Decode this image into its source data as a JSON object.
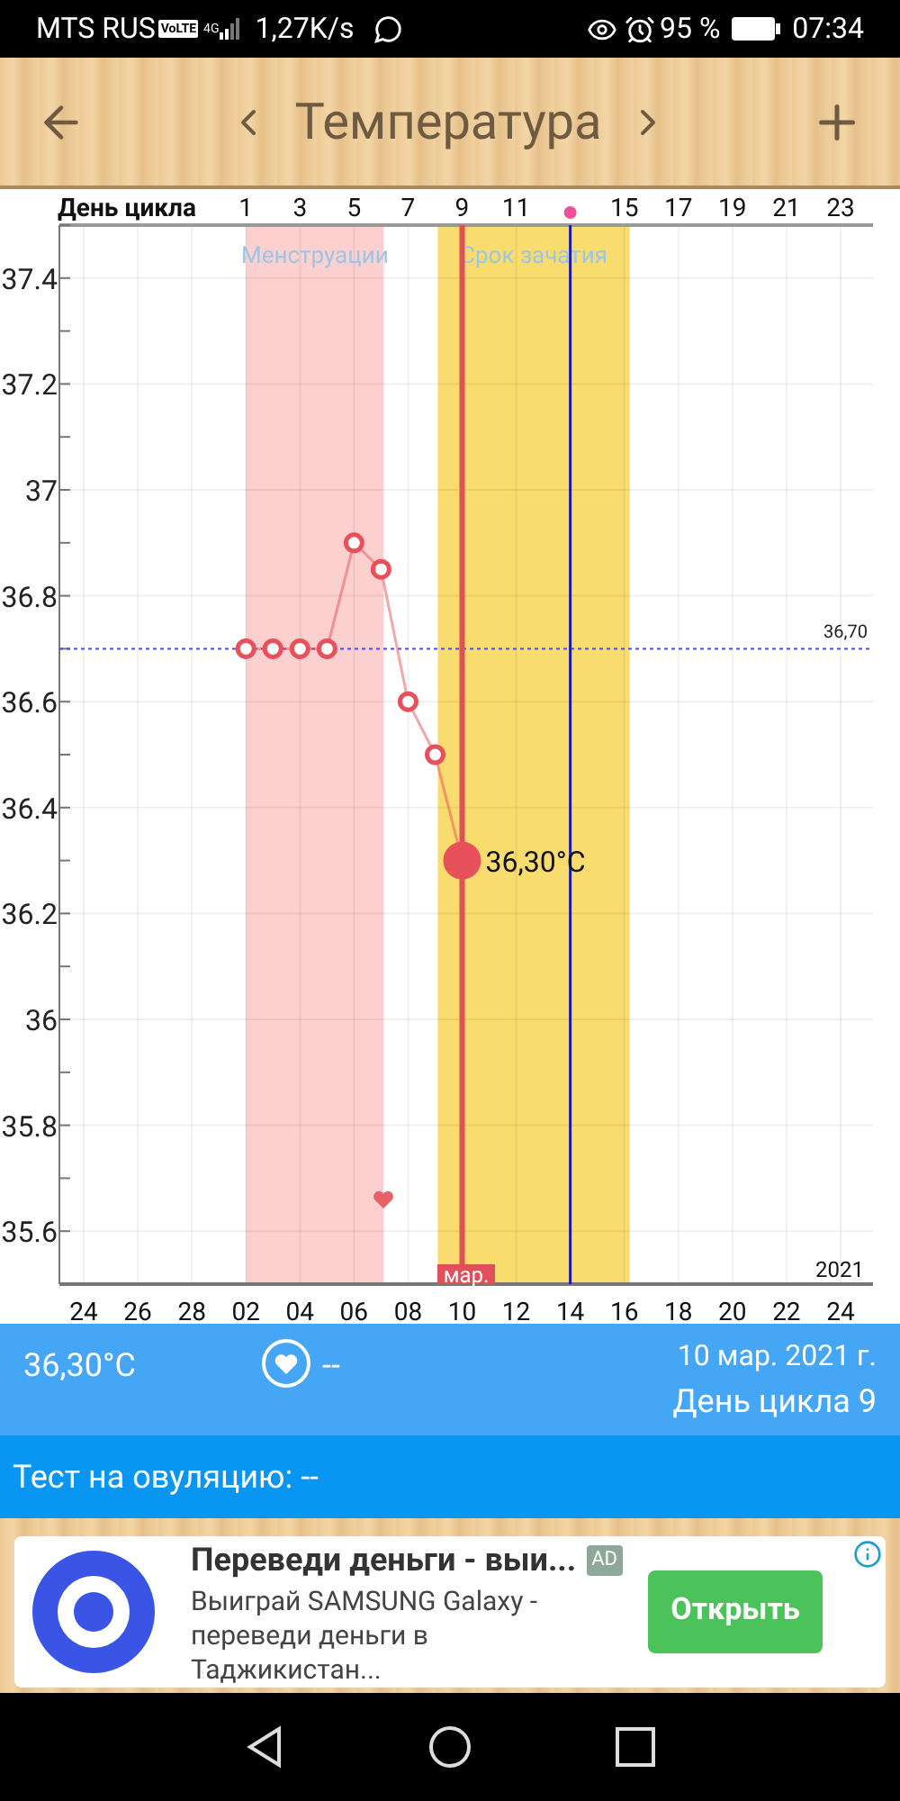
{
  "status_bar": {
    "carrier": "MTS RUS",
    "volte": "VoLTE",
    "network": "4G",
    "speed": "1,27K/s",
    "battery": "95 %",
    "time": "07:34"
  },
  "header": {
    "title": "Температура"
  },
  "chart": {
    "cycle_axis_title": "День цикла",
    "date_labels": [
      "24",
      "26",
      "28",
      "02",
      "04",
      "06",
      "08",
      "10",
      "12",
      "14",
      "16",
      "18",
      "20",
      "22",
      "24"
    ],
    "point_label": "36,30°C",
    "month_tag": "мар.",
    "year": "2021",
    "chart_data": {
      "type": "line",
      "x": [
        1,
        2,
        3,
        4,
        5,
        6,
        7,
        8,
        9
      ],
      "series": [
        {
          "color": "#e8505b",
          "marker": "o",
          "values": [
            36.7,
            36.7,
            36.7,
            36.7,
            36.9,
            36.85,
            36.6,
            36.5,
            36.3
          ]
        }
      ],
      "xlim": [
        -5.9,
        24.2
      ],
      "ylim": [
        35.5,
        37.5
      ],
      "grid": true,
      "bands": [
        {
          "axis": "x",
          "from": 1,
          "to": 6.1,
          "color": "#fdd0d0",
          "label": "Менструации"
        },
        {
          "axis": "x",
          "from": 8.1,
          "to": 15.2,
          "color": "#f9dc6e",
          "label": "Срок зачатия"
        }
      ],
      "ref_lines": [
        {
          "axis": "y",
          "value": 36.7,
          "color": "#4a4ae8",
          "label": "36,70"
        },
        {
          "axis": "x",
          "value": 9,
          "color": "#e0505a"
        },
        {
          "axis": "x",
          "value": 13,
          "color": "#1a1ab8"
        }
      ],
      "yticks": [
        37.4,
        37.2,
        37,
        36.8,
        36.6,
        36.4,
        36.2,
        36,
        35.8,
        35.6
      ],
      "xticks": [
        1,
        3,
        5,
        7,
        9,
        11,
        15,
        17,
        19,
        21,
        23
      ]
    }
  },
  "info": {
    "temperature": "36,30°C",
    "intercourse": "--",
    "date": "10 мар. 2021 г.",
    "cycle_day": "День цикла 9"
  },
  "ovulation_test": "Тест на овуляцию: --",
  "ad": {
    "title": "Переведи деньги - выи...",
    "badge": "AD",
    "description": "Выиграй SAMSUNG Galaxy - переведи деньги в Таджикистан...",
    "button": "Открыть"
  }
}
